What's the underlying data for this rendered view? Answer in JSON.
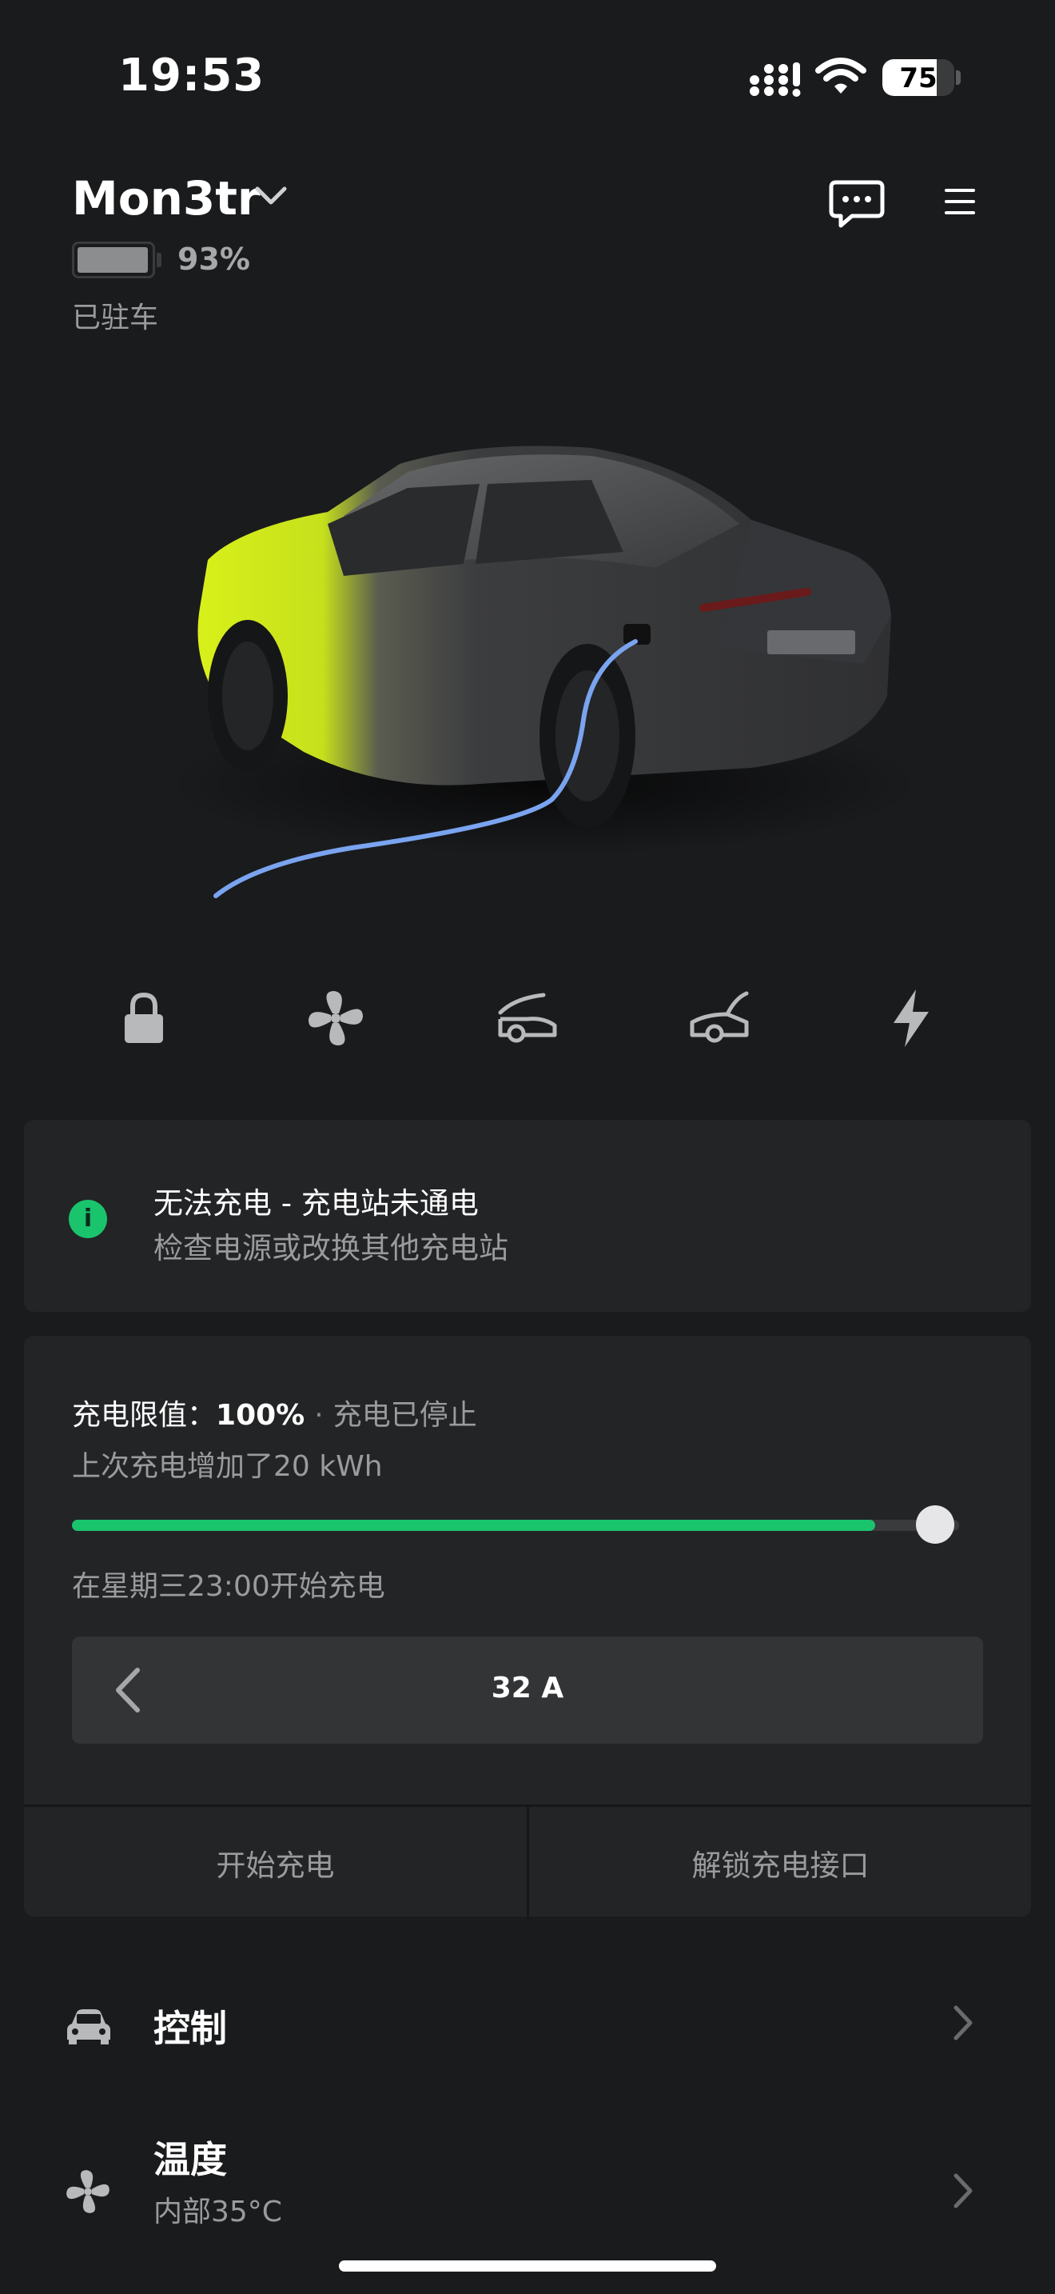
{
  "status_bar": {
    "time": "19:53",
    "battery_level": "75",
    "icons": [
      "cellular-signal-icon",
      "wifi-icon",
      "battery-icon"
    ]
  },
  "header": {
    "car_name": "Mon3tr",
    "battery_percent": "93%",
    "state": "已驻车",
    "icons": [
      "chevron-down-icon",
      "message-icon",
      "menu-icon"
    ]
  },
  "quick_actions": [
    {
      "name": "lock",
      "icon": "lock-icon"
    },
    {
      "name": "climate",
      "icon": "fan-icon"
    },
    {
      "name": "frunk",
      "icon": "frunk-icon"
    },
    {
      "name": "trunk",
      "icon": "trunk-icon"
    },
    {
      "name": "charge",
      "icon": "lightning-icon"
    }
  ],
  "alert": {
    "title": "无法充电 - 充电站未通电",
    "subtitle": "检查电源或改换其他充电站",
    "icon": "info-icon"
  },
  "charging": {
    "limit_label": "充电限值：",
    "limit_value": "100%",
    "separator": "·",
    "status": "充电已停止",
    "last_added": "上次充电增加了20 kWh",
    "slider_level": 0.9,
    "schedule": "在星期三23:00开始充电",
    "amperage": "32 A",
    "start_button": "开始充电",
    "unlock_button": "解锁充电接口"
  },
  "menu": [
    {
      "title": "控制",
      "subtitle": "",
      "icon": "car-icon"
    },
    {
      "title": "温度",
      "subtitle": "内部35°C",
      "icon": "fan-icon"
    }
  ],
  "colors": {
    "background": "#1a1b1d",
    "card": "#232426",
    "accent_green": "#19c46d",
    "car_wrap_yellow": "#d8f01a",
    "charge_cable": "#7aa4f0"
  }
}
